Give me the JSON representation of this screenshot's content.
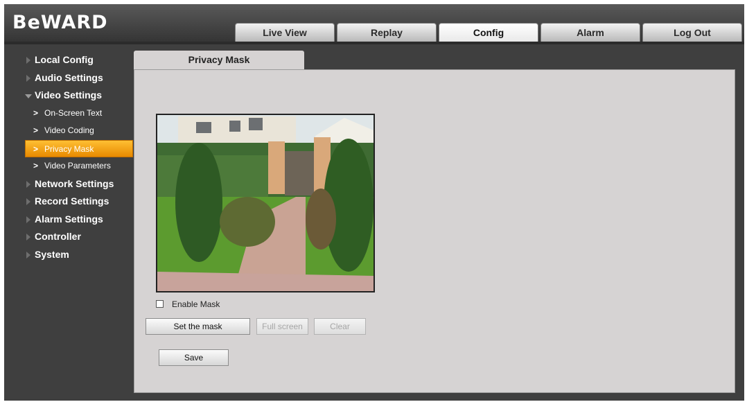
{
  "brand": {
    "logo_text": "BeWARD"
  },
  "nav": {
    "tabs": [
      {
        "label": "Live View",
        "active": false
      },
      {
        "label": "Replay",
        "active": false
      },
      {
        "label": "Config",
        "active": true
      },
      {
        "label": "Alarm",
        "active": false
      },
      {
        "label": "Log Out",
        "active": false
      }
    ]
  },
  "sidebar": {
    "items": [
      {
        "label": "Local Config"
      },
      {
        "label": "Audio Settings"
      },
      {
        "label": "Video Settings",
        "expanded": true
      },
      {
        "label": "On-Screen Text"
      },
      {
        "label": "Video Coding"
      },
      {
        "label": "Privacy Mask",
        "active": true
      },
      {
        "label": "Video Parameters"
      },
      {
        "label": "Network Settings"
      },
      {
        "label": "Record Settings"
      },
      {
        "label": "Alarm Settings"
      },
      {
        "label": "Controller"
      },
      {
        "label": "System"
      }
    ]
  },
  "content": {
    "tab_title": "Privacy Mask",
    "enable_mask_label": "Enable Mask",
    "enable_mask_checked": false,
    "buttons": {
      "set_mask": "Set the mask",
      "full_screen": "Full screen",
      "clear": "Clear",
      "save": "Save"
    }
  },
  "colors": {
    "accent": "#f29b0c",
    "background": "#3f3f3f",
    "panel": "#d6d3d3"
  }
}
